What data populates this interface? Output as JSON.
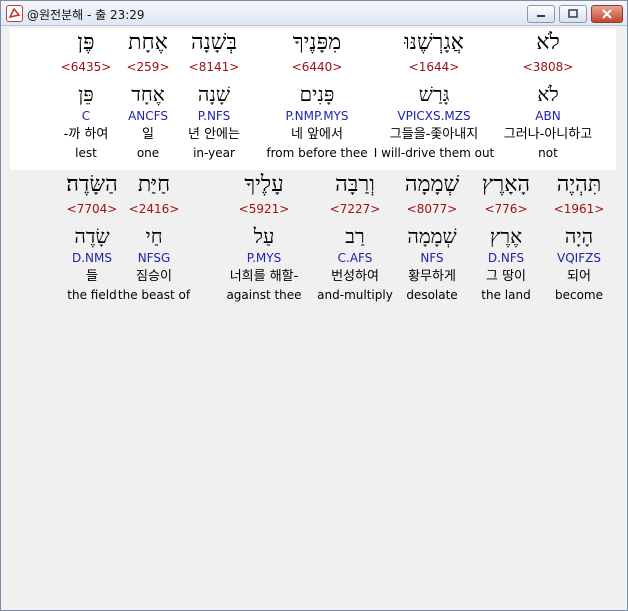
{
  "window": {
    "title": "@원전분해 - 출 23:29"
  },
  "rows": [
    [
      {
        "hebrew": "לֹא",
        "strong": "<3808>",
        "lemma": "לֹא",
        "morph": "ABN",
        "korean": "그러나-아니하고",
        "english": "not",
        "highlight": true
      },
      {
        "hebrew": "אֲגָרְשֶׁנּוּ",
        "strong": "<1644>",
        "lemma": "גָּרַשׁ",
        "morph": "VPICXS.MZS",
        "korean": "그들을-좇아내지",
        "english": "I will-drive them out"
      },
      {
        "hebrew": "מִפָּנֶיךָ",
        "strong": "<6440>",
        "lemma": "פָּנִים",
        "morph": "P.NMP.MYS",
        "korean": "네 앞에서",
        "english": "from before thee"
      },
      {
        "hebrew": "בְּשָׁנָה",
        "strong": "<8141>",
        "lemma": "שָׁנָה",
        "morph": "P.NFS",
        "korean": "년 안에는",
        "english": "in-year"
      },
      {
        "hebrew": "אֶחָת",
        "strong": "<259>",
        "lemma": "אֶחָד",
        "morph": "ANCFS",
        "korean": "일",
        "english": "one"
      },
      {
        "hebrew": "פֶּן",
        "strong": "<6435>",
        "lemma": "פֵּן",
        "morph": "C",
        "korean": "-까 하여",
        "english": "lest"
      }
    ],
    [
      {
        "hebrew": "תִּהְיֶה",
        "strong": "<1961>",
        "lemma": "הָיָה",
        "morph": "VQIFZS",
        "korean": "되어",
        "english": "become"
      },
      {
        "hebrew": "הָאָרֶץ",
        "strong": "<776>",
        "lemma": "אֶרֶץ",
        "morph": "D.NFS",
        "korean": "그 땅이",
        "english": "the land"
      },
      {
        "hebrew": "שְׁמָמָה",
        "strong": "<8077>",
        "lemma": "שְׁמָמָה",
        "morph": "NFS",
        "korean": "황무하게",
        "english": "desolate"
      },
      {
        "hebrew": "וְרַבָּה",
        "strong": "<7227>",
        "lemma": "רַב",
        "morph": "C.AFS",
        "korean": "번성하여",
        "english": "and-multiply"
      },
      {
        "hebrew": "עָלֶיךָ",
        "strong": "<5921>",
        "lemma": "עַל",
        "morph": "P.MYS",
        "korean": "너희를 해할-",
        "english": "against thee"
      },
      {
        "hebrew": "חַיַּת",
        "strong": "<2416>",
        "lemma": "חַי",
        "morph": "NFSG",
        "korean": "짐승이",
        "english": "the beast of"
      },
      {
        "hebrew": "הַשָּׂדֶה׃",
        "strong": "<7704>",
        "lemma": "שָׂדֶה",
        "morph": "D.NMS",
        "korean": "들",
        "english": "the field"
      }
    ]
  ]
}
